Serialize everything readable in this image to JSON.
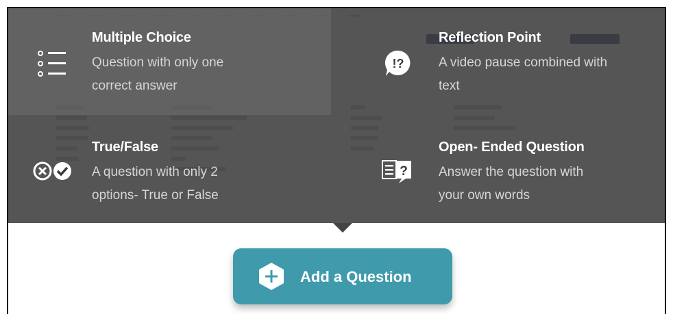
{
  "options": [
    {
      "title": "Multiple Choice",
      "desc_line1": "Question with only one",
      "desc_line2": "correct answer",
      "icon": "list-icon"
    },
    {
      "title": "Reflection Point",
      "desc_line1": "A video pause combined with",
      "desc_line2": "text",
      "icon": "exclamation-question-bubble-icon"
    },
    {
      "title": "True/False",
      "desc_line1": "A question with only 2",
      "desc_line2": "options- True or False",
      "icon": "x-check-circles-icon"
    },
    {
      "title": "Open- Ended Question",
      "desc_line1": "Answer the question with",
      "desc_line2": "your own words",
      "icon": "text-question-bubble-icon"
    }
  ],
  "add_button": {
    "label": "Add a Question",
    "icon": "plus-hexagon-icon"
  },
  "colors": {
    "overlay": "#3a3a3a",
    "button": "#3f9bac",
    "title": "#ffffff",
    "desc": "#d6d6d6"
  }
}
